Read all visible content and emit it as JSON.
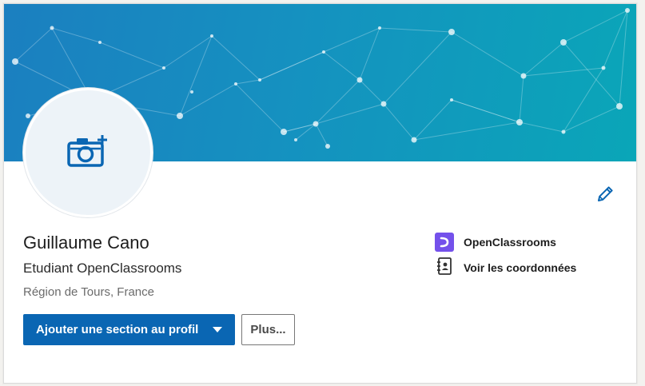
{
  "profile": {
    "name": "Guillaume Cano",
    "headline": "Etudiant OpenClassrooms",
    "location": "Région de Tours, France"
  },
  "actions": {
    "add_section_label": "Ajouter une section au profil",
    "more_label": "Plus..."
  },
  "sidebar": {
    "items": [
      {
        "label": "OpenClassrooms",
        "icon": "openclassrooms-logo-icon"
      },
      {
        "label": "Voir les coordonnées",
        "icon": "contact-book-icon"
      }
    ]
  },
  "icons": {
    "avatar": "camera-add-icon",
    "edit": "pencil-icon"
  },
  "colors": {
    "primary": "#0a66b3",
    "brand_openclassrooms": "#7451eb"
  }
}
